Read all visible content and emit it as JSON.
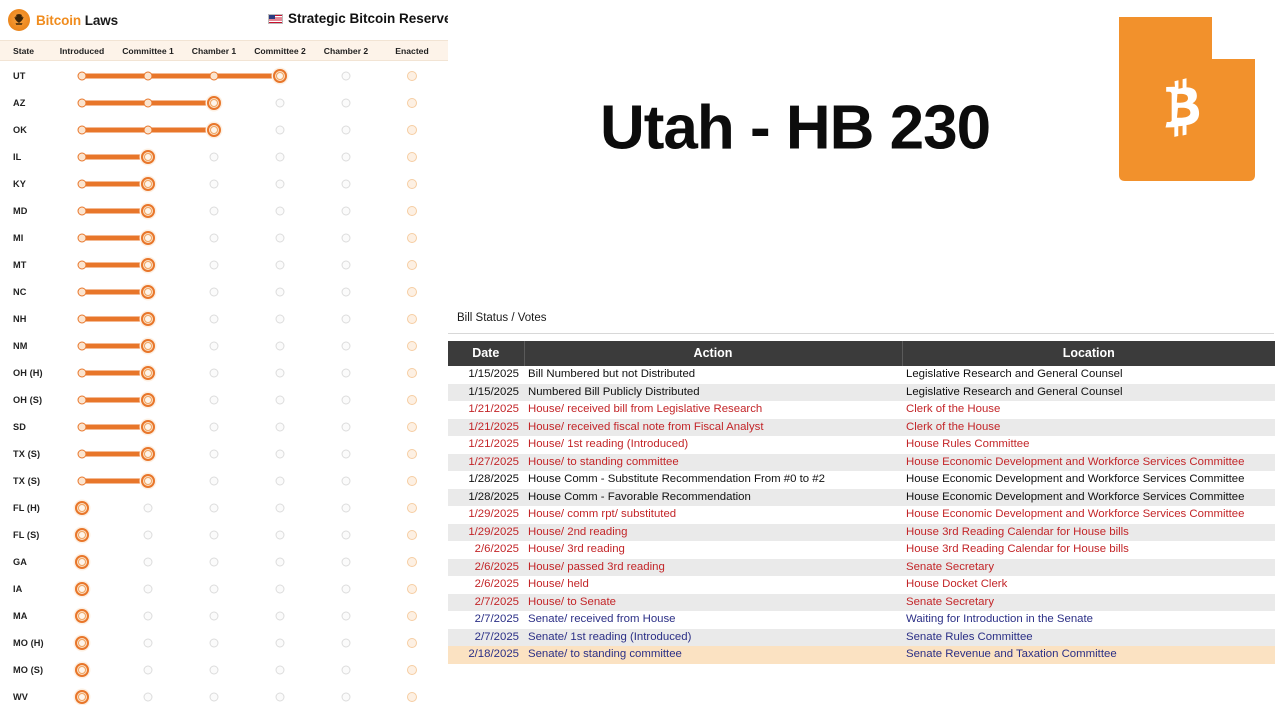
{
  "brand": {
    "logo_icon": "bitcoin-eagle-badge-icon",
    "name_highlight": "Bitcoin",
    "name_rest": " Laws"
  },
  "header": {
    "flag_icon": "us-flag-icon",
    "race_title": "Strategic Bitcoin Reserve Race"
  },
  "tracker": {
    "columns": [
      "State",
      "Introduced",
      "Committee 1",
      "Chamber 1",
      "Committee 2",
      "Chamber 2",
      "Enacted"
    ],
    "stage_count": 6,
    "colors": {
      "accent": "#e8762a",
      "header_bg": "#fdf3e9",
      "empty_gray": "#dcdcdc",
      "empty_orange": "#f6cda2"
    },
    "rows": [
      {
        "state": "UT",
        "progress": 4
      },
      {
        "state": "AZ",
        "progress": 3
      },
      {
        "state": "OK",
        "progress": 3
      },
      {
        "state": "IL",
        "progress": 2
      },
      {
        "state": "KY",
        "progress": 2
      },
      {
        "state": "MD",
        "progress": 2
      },
      {
        "state": "MI",
        "progress": 2
      },
      {
        "state": "MT",
        "progress": 2
      },
      {
        "state": "NC",
        "progress": 2
      },
      {
        "state": "NH",
        "progress": 2
      },
      {
        "state": "NM",
        "progress": 2
      },
      {
        "state": "OH (H)",
        "progress": 2
      },
      {
        "state": "OH (S)",
        "progress": 2
      },
      {
        "state": "SD",
        "progress": 2
      },
      {
        "state": "TX (S)",
        "progress": 2
      },
      {
        "state": "TX (S)",
        "progress": 2
      },
      {
        "state": "FL (H)",
        "progress": 1
      },
      {
        "state": "FL (S)",
        "progress": 1
      },
      {
        "state": "GA",
        "progress": 1
      },
      {
        "state": "IA",
        "progress": 1
      },
      {
        "state": "MA",
        "progress": 1
      },
      {
        "state": "MO (H)",
        "progress": 1
      },
      {
        "state": "MO (S)",
        "progress": 1
      },
      {
        "state": "WV",
        "progress": 1
      }
    ]
  },
  "bill": {
    "title": "Utah - HB 230",
    "state_shape_icon": "utah-state-shape-icon",
    "bitcoin_icon": "bitcoin-b-icon",
    "shape_color": "#f2912c"
  },
  "votes": {
    "section_label": "Bill Status / Votes",
    "columns": [
      "Date",
      "Action",
      "Location"
    ],
    "rows": [
      {
        "date": "1/15/2025",
        "action": "Bill Numbered but not Distributed",
        "location": "Legislative Research and General Counsel",
        "color": "black",
        "highlight": false
      },
      {
        "date": "1/15/2025",
        "action": "Numbered Bill Publicly Distributed",
        "location": "Legislative Research and General Counsel",
        "color": "black",
        "highlight": false
      },
      {
        "date": "1/21/2025",
        "action": "House/ received bill from Legislative Research",
        "location": "Clerk of the House",
        "color": "red",
        "highlight": false
      },
      {
        "date": "1/21/2025",
        "action": "House/ received fiscal note from Fiscal Analyst",
        "location": "Clerk of the House",
        "color": "red",
        "highlight": false
      },
      {
        "date": "1/21/2025",
        "action": "House/ 1st reading (Introduced)",
        "location": "House Rules Committee",
        "color": "red",
        "highlight": false
      },
      {
        "date": "1/27/2025",
        "action": "House/ to standing committee",
        "location": "House Economic Development and Workforce Services Committee",
        "color": "red",
        "highlight": false
      },
      {
        "date": "1/28/2025",
        "action": "House Comm - Substitute Recommendation From #0 to #2",
        "location": "House Economic Development and Workforce Services Committee",
        "color": "black",
        "highlight": false
      },
      {
        "date": "1/28/2025",
        "action": "House Comm - Favorable Recommendation",
        "location": "House Economic Development and Workforce Services Committee",
        "color": "black",
        "highlight": false
      },
      {
        "date": "1/29/2025",
        "action": "House/ comm rpt/ substituted",
        "location": "House Economic Development and Workforce Services Committee",
        "color": "red",
        "highlight": false
      },
      {
        "date": "1/29/2025",
        "action": "House/ 2nd reading",
        "location": "House 3rd Reading Calendar for House bills",
        "color": "red",
        "highlight": false
      },
      {
        "date": "2/6/2025",
        "action": "House/ 3rd reading",
        "location": "House 3rd Reading Calendar for House bills",
        "color": "red",
        "highlight": false
      },
      {
        "date": "2/6/2025",
        "action": "House/ passed 3rd reading",
        "location": "Senate Secretary",
        "color": "red",
        "highlight": false
      },
      {
        "date": "2/6/2025",
        "action": "House/ held",
        "location": "House Docket Clerk",
        "color": "red",
        "highlight": false
      },
      {
        "date": "2/7/2025",
        "action": "House/ to Senate",
        "location": "Senate Secretary",
        "color": "red",
        "highlight": false
      },
      {
        "date": "2/7/2025",
        "action": "Senate/ received from House",
        "location": "Waiting for Introduction in the Senate",
        "color": "navy",
        "highlight": false
      },
      {
        "date": "2/7/2025",
        "action": "Senate/ 1st reading (Introduced)",
        "location": "Senate Rules Committee",
        "color": "navy",
        "highlight": false
      },
      {
        "date": "2/18/2025",
        "action": "Senate/ to standing committee",
        "location": "Senate Revenue and Taxation Committee",
        "color": "navy",
        "highlight": true
      }
    ]
  }
}
